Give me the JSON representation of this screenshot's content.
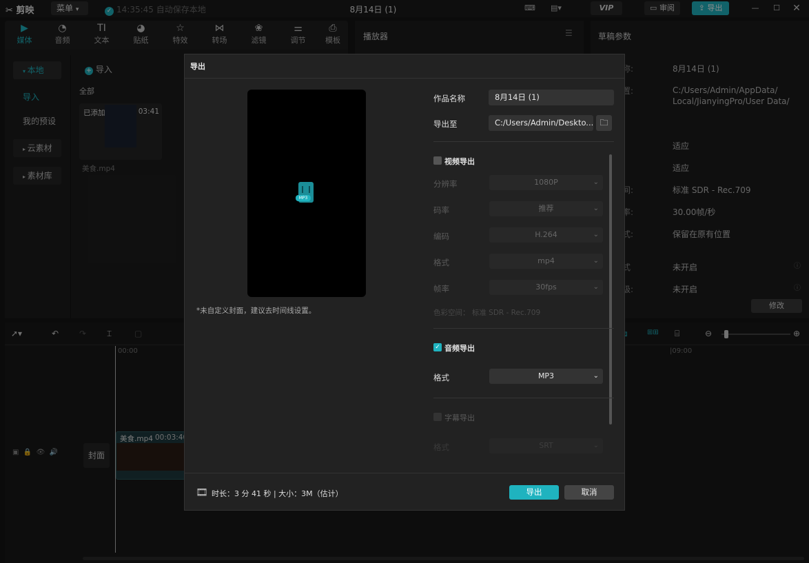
{
  "app": {
    "logo": "剪映",
    "menu_label": "菜单",
    "save_status": "14:35:45 自动保存本地",
    "project_title": "8月14日 (1)",
    "vip_label": "VIP",
    "review_label": "审阅",
    "export_label": "导出"
  },
  "media_tabs": [
    {
      "label": "媒体",
      "icon": "media-icon"
    },
    {
      "label": "音频",
      "icon": "audio-icon"
    },
    {
      "label": "文本",
      "icon": "text-icon"
    },
    {
      "label": "贴纸",
      "icon": "sticker-icon"
    },
    {
      "label": "特效",
      "icon": "effects-icon"
    },
    {
      "label": "转场",
      "icon": "transition-icon"
    },
    {
      "label": "滤镜",
      "icon": "filter-icon"
    },
    {
      "label": "调节",
      "icon": "adjust-icon"
    },
    {
      "label": "模板",
      "icon": "template-icon"
    }
  ],
  "sidebar": {
    "local": "本地",
    "import": "导入",
    "my_presets": "我的预设",
    "cloud": "云素材",
    "library": "素材库"
  },
  "media": {
    "import_btn": "导入",
    "all_label": "全部",
    "clip": {
      "added": "已添加",
      "duration": "03:41",
      "filename": "美食.mp4"
    }
  },
  "player": {
    "title": "播放器"
  },
  "params": {
    "title": "草稿参数",
    "values": [
      "8月14日 (1)",
      "C:/Users/Admin/AppData/ Local/JianyingPro/User Data/",
      "适应",
      "适应",
      "标准 SDR - Rec.709",
      "30.00帧/秒",
      "保留在原有位置",
      "未开启",
      "未开启"
    ],
    "label_tails": [
      "称:",
      "置:",
      "间:",
      "率:",
      "式:",
      "式",
      "级:"
    ],
    "modify_btn": "修改"
  },
  "timeline": {
    "tick_start": "00:00",
    "tick_end": "|09:00",
    "cover_label": "封面",
    "clip_name": "美食.mp4",
    "clip_time": "00:03:40:"
  },
  "export_dialog": {
    "title": "导出",
    "cover_note": "*未自定义封面，建议去时间线设置。",
    "preview_badge": "MP3",
    "name_label": "作品名称",
    "name_value": "8月14日 (1)",
    "path_label": "导出至",
    "path_value": "C:/Users/Admin/Deskto...",
    "video_export": {
      "label": "视频导出",
      "checked": false,
      "resolution": {
        "label": "分辨率",
        "value": "1080P"
      },
      "bitrate": {
        "label": "码率",
        "value": "推荐"
      },
      "codec": {
        "label": "编码",
        "value": "H.264"
      },
      "format": {
        "label": "格式",
        "value": "mp4"
      },
      "fps": {
        "label": "帧率",
        "value": "30fps"
      },
      "color_space": "色彩空间：  标准 SDR - Rec.709"
    },
    "audio_export": {
      "label": "音频导出",
      "checked": true,
      "format": {
        "label": "格式",
        "value": "MP3"
      }
    },
    "subtitle_export": {
      "label": "字幕导出",
      "checked": false,
      "format": {
        "label": "格式",
        "value": "SRT"
      }
    },
    "footer_info": "时长：3 分 41 秒 | 大小：3M（估计）",
    "export_btn": "导出",
    "cancel_btn": "取消"
  },
  "colors": {
    "accent": "#1fb3bf",
    "dialog_bg": "#222222",
    "panel_bg": "#1d1d1d"
  }
}
